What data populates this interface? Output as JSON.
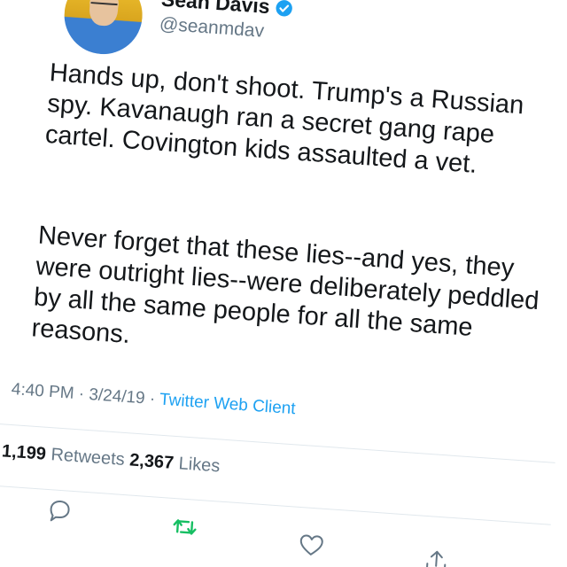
{
  "tweet": {
    "display_name": "Sean Davis",
    "handle": "@seanmdav",
    "verified": true,
    "paragraphs": [
      "Hands up, don't shoot. Trump's a Russian spy. Kavanaugh ran a secret gang rape cartel. Covington kids assaulted a vet.",
      "Never forget that these lies--and yes, they were outright lies--were deliberately peddled by all the same people for all the same reasons."
    ],
    "time": "4:40 PM",
    "date": "3/24/19",
    "separator": "·",
    "client": "Twitter Web Client",
    "retweets_count": "1,199",
    "retweets_label": "Retweets",
    "likes_count": "2,367",
    "likes_label": "Likes"
  },
  "colors": {
    "accent": "#1da1f2",
    "retweet_green": "#17bf63",
    "muted": "#657786",
    "text": "#14171a"
  },
  "icons": {
    "verified": "verified-badge-icon",
    "reply": "reply-icon",
    "retweet": "retweet-icon",
    "like": "heart-icon",
    "share": "share-icon"
  }
}
